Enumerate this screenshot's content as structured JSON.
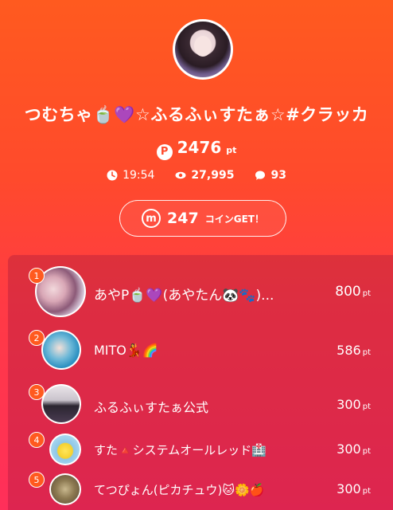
{
  "profile": {
    "name": "つむちゃ🍵💜☆ふるふぃすたぁ☆#クラッカ",
    "points_icon": "P",
    "points": "2476",
    "points_unit": "pt",
    "time": "19:54",
    "views": "27,995",
    "comments": "93"
  },
  "coin": {
    "icon": "m",
    "amount": "247",
    "label": "コインGET！"
  },
  "ranking": [
    {
      "rank": "1",
      "name": "あやP🍵💜(あやたん🐼🐾)...",
      "points": "800",
      "unit": "pt"
    },
    {
      "rank": "2",
      "name": "MITO💃🌈",
      "points": "586",
      "unit": "pt"
    },
    {
      "rank": "3",
      "name": "ふるふぃすたぁ公式",
      "points": "300",
      "unit": "pt"
    },
    {
      "rank": "4",
      "name": "すた🔺システムオールレッド🏥",
      "points": "300",
      "unit": "pt"
    },
    {
      "rank": "5",
      "name": "てつぴょん(ピカチュウ)🐱🌼🍎",
      "points": "300",
      "unit": "pt"
    }
  ],
  "colors": {
    "bg_top": "#ff5a1f",
    "bg_bottom": "#ff2f5a",
    "badge": "#ff5a1f"
  },
  "icons": [
    "profile-avatar",
    "p-points-icon",
    "clock-icon",
    "eye-icon",
    "comment-icon",
    "m-coin-icon"
  ]
}
